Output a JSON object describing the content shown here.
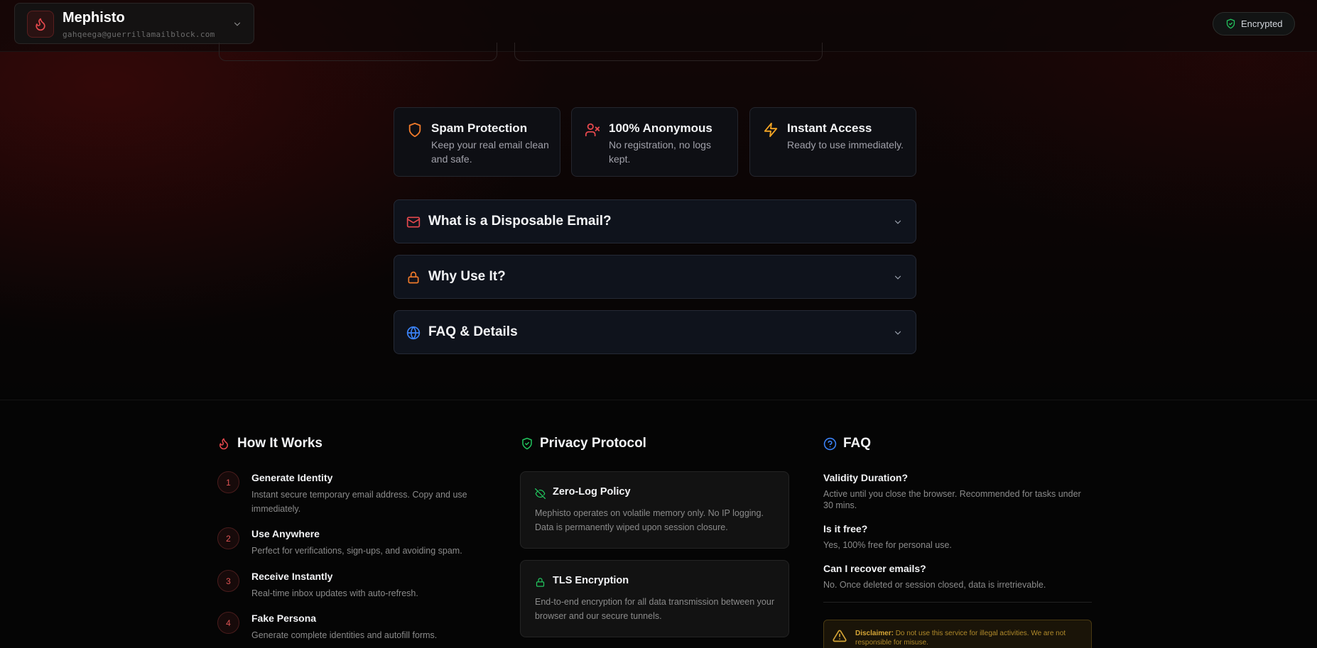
{
  "header": {
    "account_name": "Mephisto",
    "account_email": "gahqeega@guerrillamailblock.com",
    "status_label": "Encrypted"
  },
  "features": [
    {
      "title": "Spam Protection",
      "desc": "Keep your real email clean and safe.",
      "icon": "shield-icon"
    },
    {
      "title": "100% Anonymous",
      "desc": "No registration, no logs kept.",
      "icon": "user-x-icon"
    },
    {
      "title": "Instant Access",
      "desc": "Ready to use immediately.",
      "icon": "lightning-icon"
    }
  ],
  "accordions": [
    {
      "title": "What is a Disposable Email?",
      "icon": "mail-icon"
    },
    {
      "title": "Why Use It?",
      "icon": "lock-icon"
    },
    {
      "title": "FAQ & Details",
      "icon": "globe-icon"
    }
  ],
  "how_it_works": {
    "title": "How It Works",
    "steps": [
      {
        "num": "1",
        "title": "Generate Identity",
        "desc": "Instant secure temporary email address. Copy and use immediately."
      },
      {
        "num": "2",
        "title": "Use Anywhere",
        "desc": "Perfect for verifications, sign-ups, and avoiding spam."
      },
      {
        "num": "3",
        "title": "Receive Instantly",
        "desc": "Real-time inbox updates with auto-refresh."
      },
      {
        "num": "4",
        "title": "Fake Persona",
        "desc": "Generate complete identities and autofill forms."
      }
    ]
  },
  "privacy": {
    "title": "Privacy Protocol",
    "cards": [
      {
        "title": "Zero-Log Policy",
        "desc": "Mephisto operates on volatile memory only. No IP logging. Data is permanently wiped upon session closure.",
        "icon": "eye-off-icon"
      },
      {
        "title": "TLS Encryption",
        "desc": "End-to-end encryption for all data transmission between your browser and our secure tunnels.",
        "icon": "lock-icon"
      }
    ]
  },
  "faq": {
    "title": "FAQ",
    "items": [
      {
        "q": "Validity Duration?",
        "a": "Active until you close the browser. Recommended for tasks under 30 mins."
      },
      {
        "q": "Is it free?",
        "a": "Yes, 100% free for personal use."
      },
      {
        "q": "Can I recover emails?",
        "a": "No. Once deleted or session closed, data is irretrievable."
      }
    ],
    "disclaimer_label": "Disclaimer:",
    "disclaimer_text": "Do not use this service for illegal activities. We are not responsible for misuse."
  },
  "colors": {
    "accent_red": "#e5484d",
    "accent_orange": "#f07a2a",
    "accent_amber": "#f5a524",
    "accent_green": "#22c55e",
    "accent_blue": "#3b82f6"
  }
}
